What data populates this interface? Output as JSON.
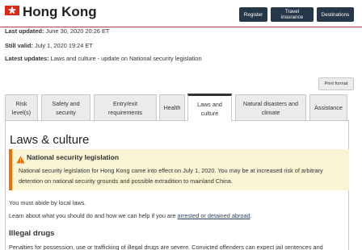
{
  "header": {
    "title": "Hong Kong",
    "buttons": {
      "register": "Register",
      "travel_insurance": "Travel insurance",
      "destinations": "Destinations"
    }
  },
  "meta": {
    "last_updated_label": "Last updated:",
    "last_updated_value": "June 30, 2020 20:26 ET",
    "still_valid_label": "Still valid:",
    "still_valid_value": "July 1, 2020 19:24 ET",
    "latest_updates_label": "Latest updates:",
    "latest_updates_value": "Laws and culture - update on National security legislation"
  },
  "print_button": "Print format",
  "tabs": [
    {
      "line1": "Risk",
      "line2": "level(s)"
    },
    {
      "line1": "Safety and",
      "line2": "security"
    },
    {
      "line1": "Entry/exit",
      "line2": "requirements"
    },
    {
      "line1": "Health",
      "line2": ""
    },
    {
      "line1": "Laws and",
      "line2": "culture"
    },
    {
      "line1": "Natural disasters and",
      "line2": "climate"
    },
    {
      "line1": "Assistance",
      "line2": ""
    }
  ],
  "content": {
    "section_title": "Laws & culture",
    "alert": {
      "title": "National security legislation",
      "body_line1": "National security legislation for Hong Kong came into effect on July 1, 2020. You may be at increased risk of arbitrary",
      "body_line2": "detention on national security grounds and possible extradition to mainland China."
    },
    "para1": "You must abide by local laws.",
    "para2_prefix": "Learn about what you should do and how we can help if you are ",
    "para2_link": "arrested or detained abroad",
    "para2_suffix": ".",
    "subheading": "Illegal drugs",
    "para3": "Penalties for possession, use or trafficking of illegal drugs are severe. Convicted offenders can expect jail sentences and"
  },
  "colors": {
    "header_button": "#26374a",
    "rule": "#af3c43",
    "alert_background": "#f9f4d4",
    "alert_border": "#ee7100",
    "flag": "#de2910",
    "link": "#284162"
  },
  "icons": {
    "flag": "hong-kong-flag-icon",
    "alert": "warning-triangle-icon"
  }
}
